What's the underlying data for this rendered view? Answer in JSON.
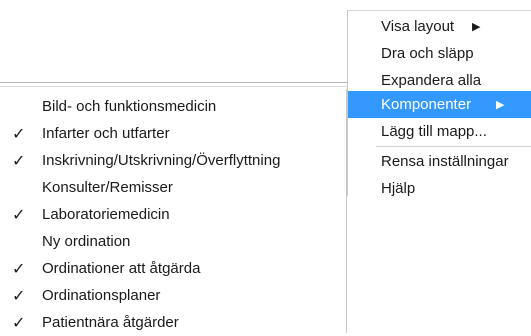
{
  "context_menu": {
    "items": [
      {
        "label": "Visa layout",
        "has_submenu": true
      },
      {
        "label": "Dra och släpp",
        "has_submenu": false
      },
      {
        "label": "Expandera alla",
        "has_submenu": false
      },
      {
        "label": "Komponenter",
        "has_submenu": true,
        "selected": true
      },
      {
        "label": "Lägg till mapp...",
        "has_submenu": false
      },
      {
        "label": "Rensa inställningar",
        "has_submenu": false
      },
      {
        "label": "Hjälp",
        "has_submenu": false
      }
    ],
    "arrow_glyph": "▶",
    "selected_color": "#3399ff"
  },
  "components_submenu": {
    "check_glyph": "✓",
    "items": [
      {
        "label": "Bild- och funktionsmedicin",
        "checked": false
      },
      {
        "label": "Infarter och utfarter",
        "checked": true
      },
      {
        "label": "Inskrivning/Utskrivning/Överflyttning",
        "checked": true
      },
      {
        "label": "Konsulter/Remisser",
        "checked": false
      },
      {
        "label": "Laboratoriemedicin",
        "checked": true
      },
      {
        "label": "Ny ordination",
        "checked": false
      },
      {
        "label": "Ordinationer att åtgärda",
        "checked": true
      },
      {
        "label": "Ordinationsplaner",
        "checked": true
      },
      {
        "label": "Patientnära åtgärder",
        "checked": true
      }
    ]
  }
}
